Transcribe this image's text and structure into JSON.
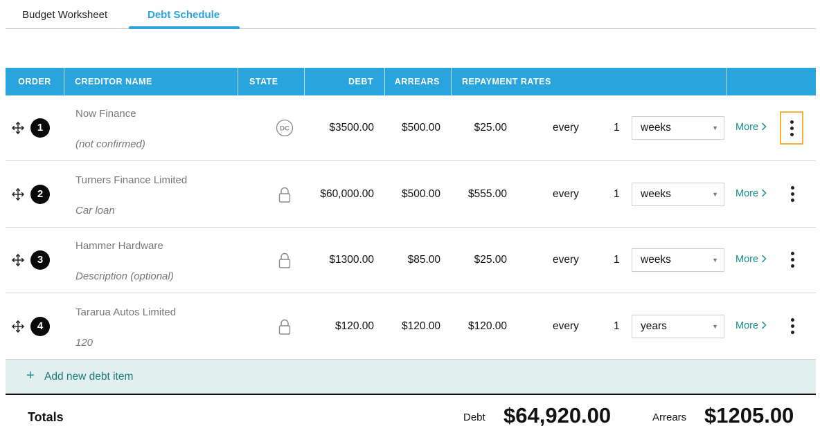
{
  "tabs": [
    {
      "label": "Budget Worksheet"
    },
    {
      "label": "Debt Schedule"
    }
  ],
  "active_tab": "Debt Schedule",
  "table": {
    "headers": {
      "order": "ORDER",
      "creditor": "CREDITOR NAME",
      "state": "STATE",
      "debt": "DEBT",
      "arrears": "ARREARS",
      "repayment": "REPAYMENT RATES"
    },
    "rows": [
      {
        "order": "1",
        "creditor": "Now Finance",
        "description": "(not confirmed)",
        "state_icon": "dc-icon",
        "state_text": "DC",
        "debt": "$3500.00",
        "arrears": "$500.00",
        "rate": "$25.00",
        "every": "every",
        "count": "1",
        "period": "weeks",
        "more": "More"
      },
      {
        "order": "2",
        "creditor": "Turners Finance Limited",
        "description": "Car loan",
        "state_icon": "lock-icon",
        "debt": "$60,000.00",
        "arrears": "$500.00",
        "rate": "$555.00",
        "every": "every",
        "count": "1",
        "period": "weeks",
        "more": "More"
      },
      {
        "order": "3",
        "creditor": "Hammer Hardware",
        "description": "Description (optional)",
        "state_icon": "lock-icon",
        "debt": "$1300.00",
        "arrears": "$85.00",
        "rate": "$25.00",
        "every": "every",
        "count": "1",
        "period": "weeks",
        "more": "More"
      },
      {
        "order": "4",
        "creditor": "Tararua Autos Limited",
        "description": "120",
        "state_icon": "lock-icon",
        "debt": "$120.00",
        "arrears": "$120.00",
        "rate": "$120.00",
        "every": "every",
        "count": "1",
        "period": "years",
        "more": "More"
      }
    ],
    "add_label": "Add new debt item"
  },
  "totals": {
    "label": "Totals",
    "debt_label": "Debt",
    "debt_value": "$64,920.00",
    "arrears_label": "Arrears",
    "arrears_value": "$1205.00"
  },
  "colors": {
    "accent": "#29a4dc",
    "teal": "#1a8c8c",
    "add_row_bg": "#e1efee",
    "focus_outline": "#f0b237"
  }
}
